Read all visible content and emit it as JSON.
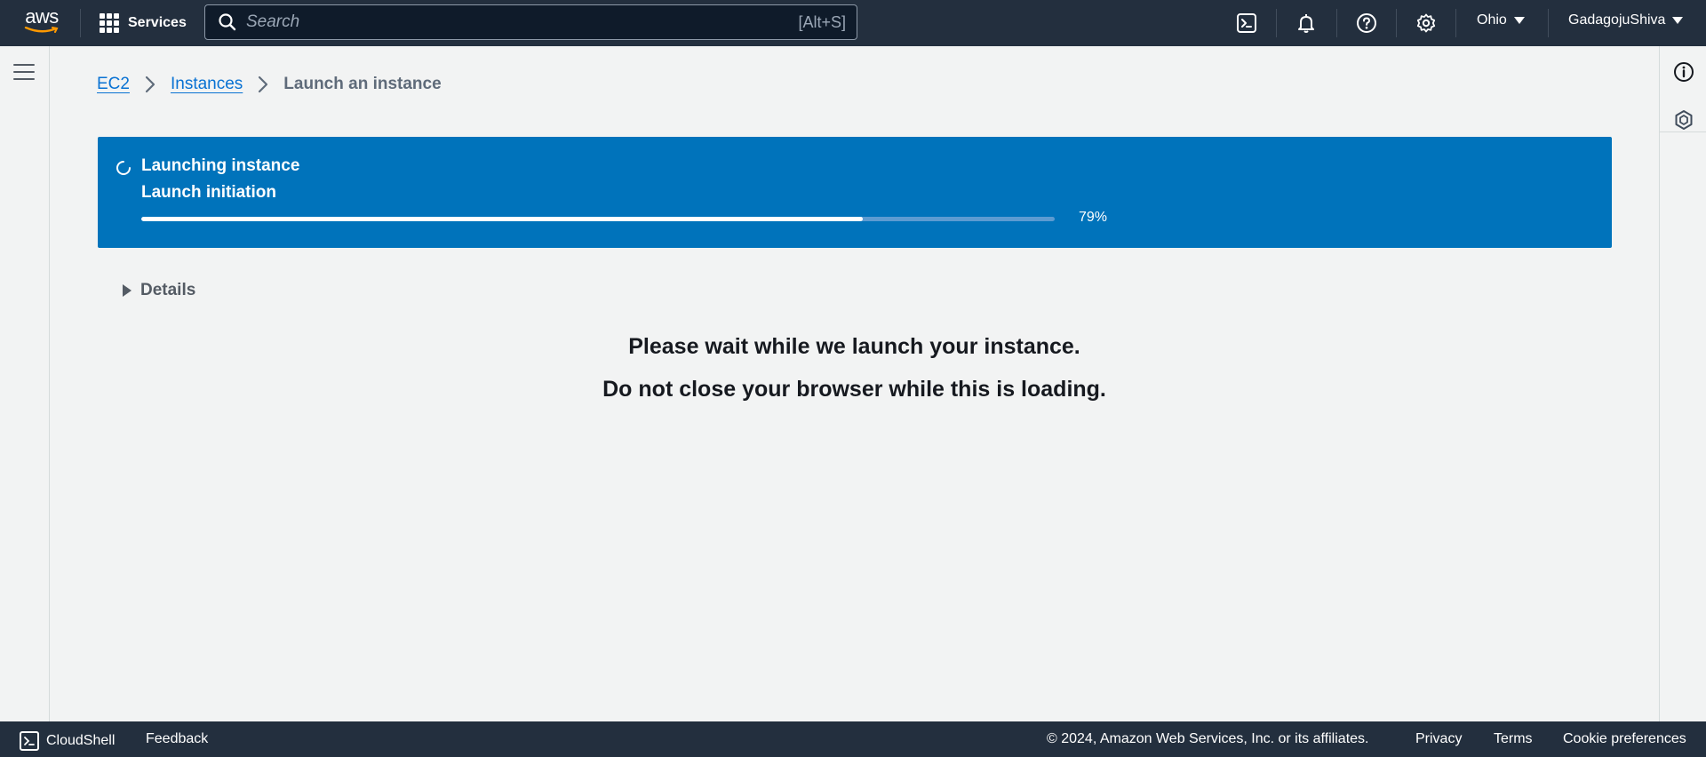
{
  "topnav": {
    "logo_text": "aws",
    "services_label": "Services",
    "search_placeholder": "Search",
    "search_shortcut": "[Alt+S]",
    "region": "Ohio",
    "user": "GadagojuShiva",
    "icons": [
      "cloudshell-icon",
      "bell-icon",
      "help-icon",
      "settings-icon"
    ]
  },
  "breadcrumb": {
    "items": [
      {
        "label": "EC2"
      },
      {
        "label": "Instances"
      },
      {
        "label": "Launch an instance"
      }
    ]
  },
  "flash": {
    "title": "Launching instance",
    "subtitle": "Launch initiation",
    "progress": 79,
    "progress_label": "79%",
    "color": "#0073bb"
  },
  "details": {
    "label": "Details"
  },
  "messages": {
    "line1": "Please wait while we launch your instance.",
    "line2": "Do not close your browser while this is loading."
  },
  "footer": {
    "cloudshell": "CloudShell",
    "feedback": "Feedback",
    "copyright": "© 2024, Amazon Web Services, Inc. or its affiliates.",
    "privacy": "Privacy",
    "terms": "Terms",
    "cookies": "Cookie preferences"
  },
  "colors": {
    "nav_bg": "#232f3e",
    "link": "#0972d3",
    "page_bg": "#f2f3f3",
    "aws_smile": "#ff9900"
  }
}
